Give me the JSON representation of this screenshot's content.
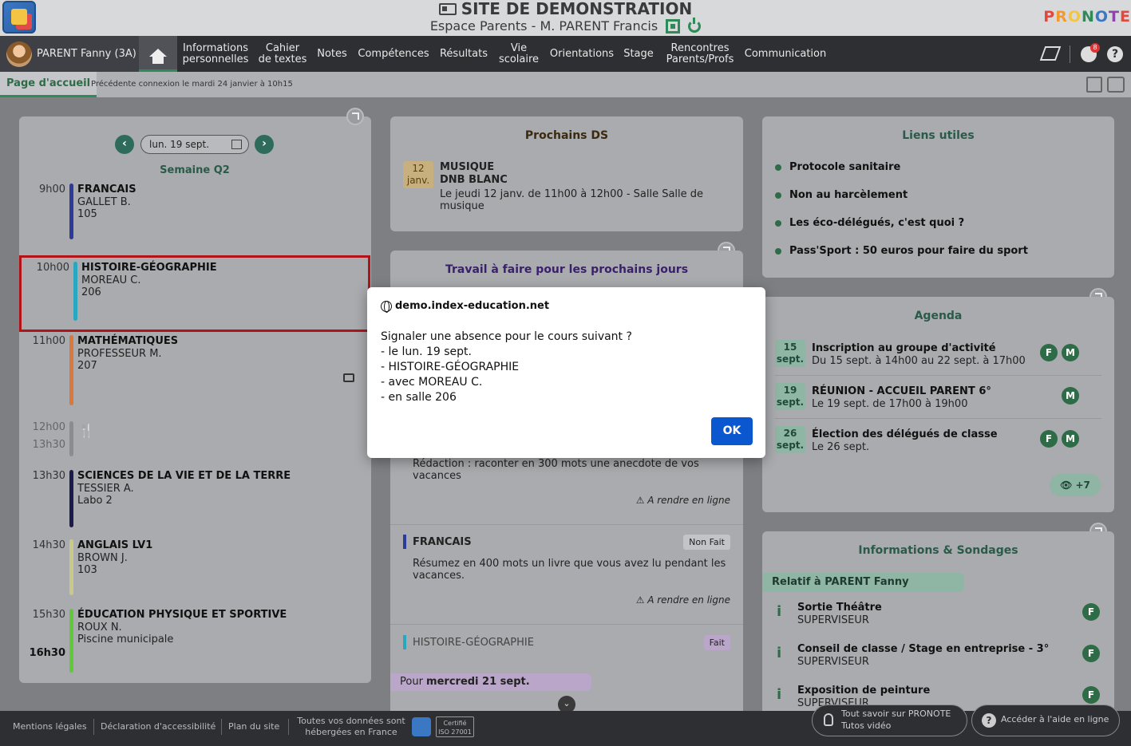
{
  "header": {
    "title": "SITE DE DEMONSTRATION",
    "subtitle": "Espace Parents - M. PARENT Francis",
    "brand": "PRONOTE",
    "brand_colors": [
      "#e6463c",
      "#f29a2e",
      "#f4c542",
      "#2e8b57",
      "#3a78c4",
      "#8e44ad",
      "#e6463c"
    ]
  },
  "nav": {
    "user": "PARENT Fanny (3A)",
    "items": [
      {
        "label": "Informations\npersonnelles"
      },
      {
        "label": "Cahier\nde textes"
      },
      {
        "label": "Notes"
      },
      {
        "label": "Compétences"
      },
      {
        "label": "Résultats"
      },
      {
        "label": "Vie\nscolaire"
      },
      {
        "label": "Orientations"
      },
      {
        "label": "Stage"
      },
      {
        "label": "Rencontres\nParents/Profs"
      },
      {
        "label": "Communication"
      }
    ],
    "badge": "8"
  },
  "subbar": {
    "tab": "Page d'accueil",
    "prev_connection": "Précédente connexion le mardi 24 janvier à 10h15"
  },
  "schedule": {
    "date": "lun. 19 sept.",
    "week": "Semaine Q2",
    "courses": [
      {
        "time": "9h00",
        "name": "FRANCAIS",
        "teacher": "GALLET B.",
        "room": "105",
        "color": "#2b3a9b"
      },
      {
        "time": "10h00",
        "name": "HISTOIRE-GÉOGRAPHIE",
        "teacher": "MOREAU C.",
        "room": "206",
        "color": "#2aa7c0"
      },
      {
        "time": "11h00",
        "name": "MATHÉMATIQUES",
        "teacher": "PROFESSEUR M.",
        "room": "207",
        "color": "#d9783a"
      },
      {
        "time": "12h00",
        "time2": "13h30"
      },
      {
        "time": "13h30",
        "name": "SCIENCES DE LA VIE ET DE LA TERRE",
        "teacher": "TESSIER A.",
        "room": "Labo 2",
        "color": "#1a1a4e"
      },
      {
        "time": "14h30",
        "name": "ANGLAIS LV1",
        "teacher": "BROWN J.",
        "room": "103",
        "color": "#c9c98a"
      },
      {
        "time": "15h30",
        "time_end": "16h30",
        "name": "ÉDUCATION PHYSIQUE ET SPORTIVE",
        "teacher": "ROUX N.",
        "room": "Piscine municipale",
        "color": "#5fc93a"
      }
    ]
  },
  "ds": {
    "title": "Prochains DS",
    "date_day": "12",
    "date_month": "janv.",
    "subject": "MUSIQUE",
    "kind": "DNB BLANC",
    "detail": "Le jeudi 12 janv. de 11h00 à 12h00  - Salle Salle de\nmusique"
  },
  "travail": {
    "title": "Travail à faire pour les prochains jours",
    "items": [
      {
        "text": "Rédaction : raconter en 300 mots une anecdote de vos\nvacances",
        "footer": "A rendre en ligne"
      },
      {
        "subject": "FRANCAIS",
        "status": "Non Fait",
        "text": "Résumez en 400 mots un livre que vous avez lu pendant les\nvacances.",
        "footer": "A rendre en ligne"
      },
      {
        "subject": "HISTOIRE-GÉOGRAPHIE",
        "status": "Fait"
      }
    ],
    "next_day_prefix": "Pour ",
    "next_day": "mercredi 21 sept."
  },
  "liens": {
    "title": "Liens utiles",
    "items": [
      "Protocole sanitaire",
      "Non au harcèlement",
      "Les éco-délégués, c'est quoi ?",
      "Pass'Sport : 50 euros pour faire du sport"
    ]
  },
  "agenda": {
    "title": "Agenda",
    "items": [
      {
        "day": "15",
        "month": "sept.",
        "title": "Inscription au groupe d'activité",
        "sub": "Du 15 sept. à 14h00 au 22 sept. à 17h00",
        "pills": [
          "F",
          "M"
        ]
      },
      {
        "day": "19",
        "month": "sept.",
        "title": "RÉUNION - ACCUEIL PARENT 6°",
        "sub": "Le 19 sept. de 17h00 à 19h00",
        "pills": [
          "M"
        ]
      },
      {
        "day": "26",
        "month": "sept.",
        "title": "Élection des délégués de classe",
        "sub": "Le 26 sept.",
        "pills": [
          "F",
          "M"
        ]
      }
    ],
    "more": "+7"
  },
  "infos": {
    "title": "Informations & Sondages",
    "relatif": "Relatif à PARENT Fanny",
    "items": [
      {
        "title": "Sortie Théâtre",
        "sub": "SUPERVISEUR",
        "pill": "F"
      },
      {
        "title": "Conseil de classe / Stage en entreprise - 3°",
        "sub": "SUPERVISEUR",
        "pill": "F"
      },
      {
        "title": "Exposition de peinture",
        "sub": "SUPERVISEUR",
        "pill": "F"
      }
    ]
  },
  "footer": {
    "links": [
      "Mentions légales",
      "Déclaration d'accessibilité",
      "Plan du site"
    ],
    "hosted": "Toutes vos données sont\nhébergées en France",
    "certif": "Certifié\nISO 27001",
    "tuto_title": "Tout savoir sur PRONOTE",
    "tuto_sub": "Tutos vidéo",
    "help": "Accéder à l'aide en ligne"
  },
  "dialog": {
    "host": "demo.index-education.net",
    "message": "Signaler une absence pour le cours suivant ?\n - le lun. 19 sept.\n - HISTOIRE-GÉOGRAPHIE\n - avec MOREAU C.\n - en salle 206",
    "ok": "OK"
  }
}
